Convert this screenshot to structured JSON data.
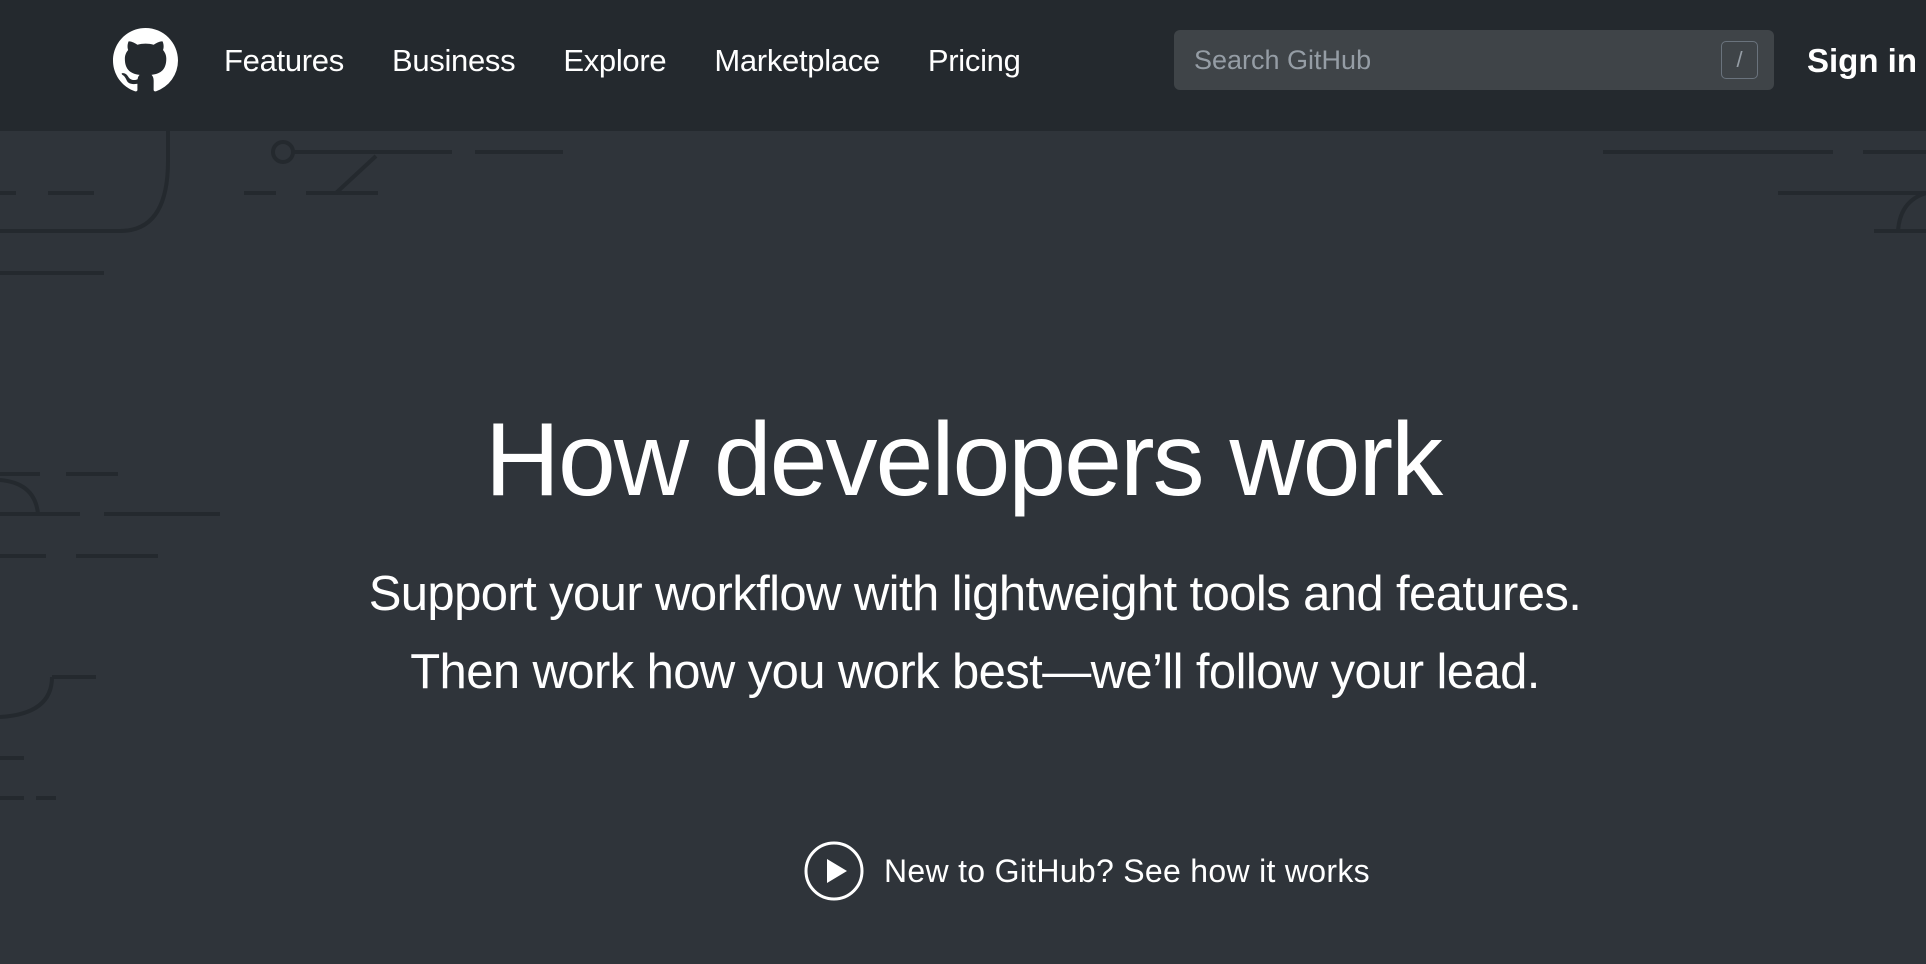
{
  "header": {
    "logo_icon": "github-octocat-icon",
    "nav": [
      {
        "label": "Features"
      },
      {
        "label": "Business"
      },
      {
        "label": "Explore"
      },
      {
        "label": "Marketplace"
      },
      {
        "label": "Pricing"
      }
    ],
    "search": {
      "placeholder": "Search GitHub",
      "shortcut_key": "/"
    },
    "signin_label": "Sign in"
  },
  "hero": {
    "title": "How developers work",
    "subtitle": "Support your workflow with lightweight tools and features. Then work how you work best—we’ll follow your lead.",
    "video_link_label": "New to GitHub? See how it works",
    "video_icon": "play-circle-icon"
  },
  "colors": {
    "header_bg": "#24292e",
    "hero_bg": "#2f343a",
    "search_bg": "#3f4448",
    "text": "#ffffff",
    "placeholder": "#959da5"
  }
}
